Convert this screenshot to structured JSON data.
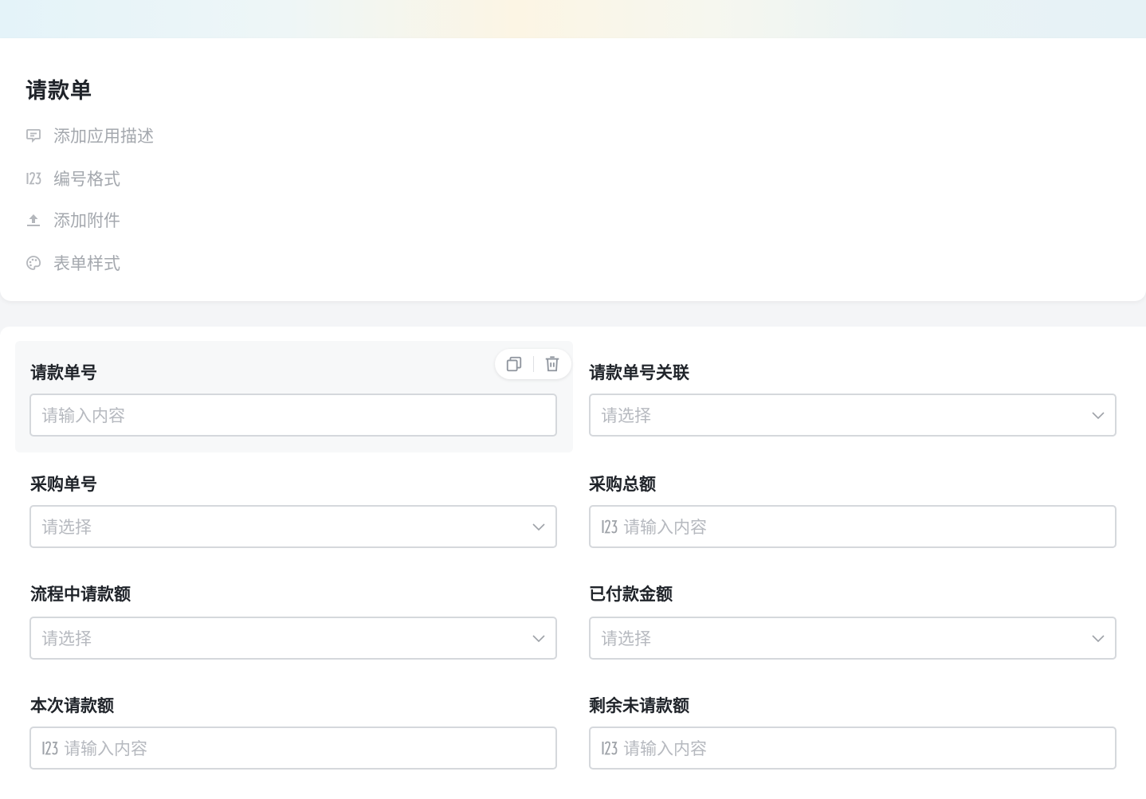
{
  "form": {
    "title": "请款单",
    "menu": [
      {
        "label": "添加应用描述",
        "icon": "comment-icon"
      },
      {
        "label": "编号格式",
        "icon": "number-format-icon"
      },
      {
        "label": "添加附件",
        "icon": "upload-icon"
      },
      {
        "label": "表单样式",
        "icon": "palette-icon"
      }
    ]
  },
  "fields": [
    {
      "label": "请款单号",
      "type": "text",
      "placeholder": "请输入内容",
      "selected": true
    },
    {
      "label": "请款单号关联",
      "type": "select",
      "placeholder": "请选择"
    },
    {
      "label": "采购单号",
      "type": "select",
      "placeholder": "请选择"
    },
    {
      "label": "采购总额",
      "type": "number",
      "placeholder": "请输入内容"
    },
    {
      "label": "流程中请款额",
      "type": "select",
      "placeholder": "请选择"
    },
    {
      "label": "已付款金额",
      "type": "select",
      "placeholder": "请选择"
    },
    {
      "label": "本次请款额",
      "type": "number",
      "placeholder": "请输入内容"
    },
    {
      "label": "剩余未请款额",
      "type": "number",
      "placeholder": "请输入内容"
    }
  ],
  "field_actions": [
    {
      "name": "copy-icon"
    },
    {
      "name": "delete-icon"
    }
  ]
}
